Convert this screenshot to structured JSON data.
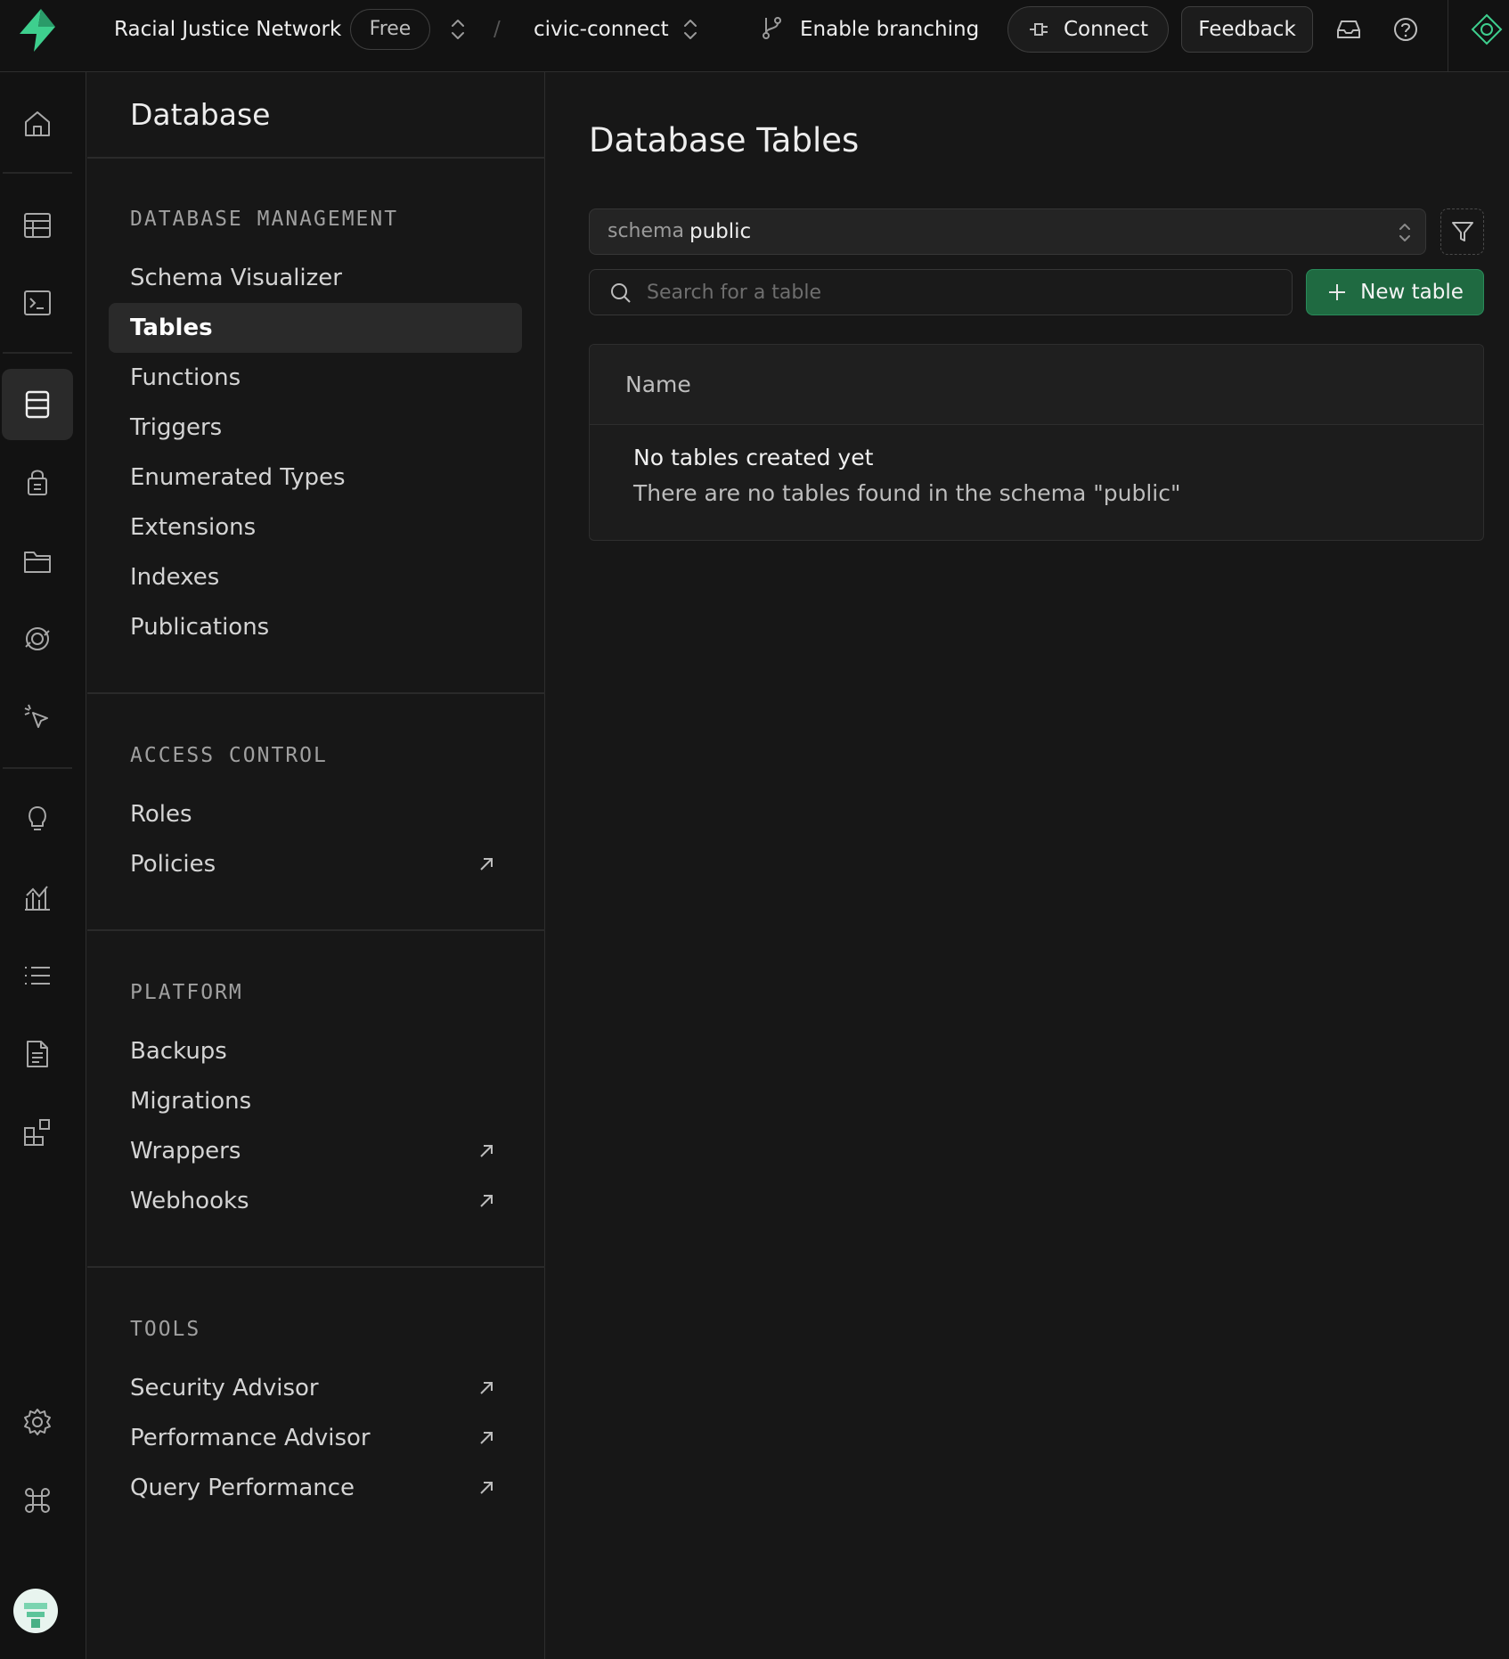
{
  "topbar": {
    "org_name": "Racial Justice Network",
    "plan_badge": "Free",
    "separator": "/",
    "project_name": "civic-connect",
    "branching_label": "Enable branching",
    "connect_label": "Connect",
    "feedback_label": "Feedback"
  },
  "rail": {
    "icons": [
      "home-icon",
      "table-editor-icon",
      "sql-editor-icon",
      "database-icon",
      "auth-icon",
      "storage-icon",
      "realtime-icon",
      "edge-functions-icon",
      "advisors-icon",
      "reports-icon",
      "logs-icon",
      "api-docs-icon",
      "integrations-icon",
      "settings-icon",
      "command-icon"
    ]
  },
  "sidebar": {
    "title": "Database",
    "sections": [
      {
        "heading": "DATABASE MANAGEMENT",
        "items": [
          {
            "label": "Schema Visualizer",
            "external": false,
            "active": false
          },
          {
            "label": "Tables",
            "external": false,
            "active": true
          },
          {
            "label": "Functions",
            "external": false,
            "active": false
          },
          {
            "label": "Triggers",
            "external": false,
            "active": false
          },
          {
            "label": "Enumerated Types",
            "external": false,
            "active": false
          },
          {
            "label": "Extensions",
            "external": false,
            "active": false
          },
          {
            "label": "Indexes",
            "external": false,
            "active": false
          },
          {
            "label": "Publications",
            "external": false,
            "active": false
          }
        ]
      },
      {
        "heading": "ACCESS CONTROL",
        "items": [
          {
            "label": "Roles",
            "external": false,
            "active": false
          },
          {
            "label": "Policies",
            "external": true,
            "active": false
          }
        ]
      },
      {
        "heading": "PLATFORM",
        "items": [
          {
            "label": "Backups",
            "external": false,
            "active": false
          },
          {
            "label": "Migrations",
            "external": false,
            "active": false
          },
          {
            "label": "Wrappers",
            "external": true,
            "active": false
          },
          {
            "label": "Webhooks",
            "external": true,
            "active": false
          }
        ]
      },
      {
        "heading": "TOOLS",
        "items": [
          {
            "label": "Security Advisor",
            "external": true,
            "active": false
          },
          {
            "label": "Performance Advisor",
            "external": true,
            "active": false
          },
          {
            "label": "Query Performance",
            "external": true,
            "active": false
          }
        ]
      }
    ]
  },
  "main": {
    "title": "Database Tables",
    "schema_key": "schema",
    "schema_value": "public",
    "search_placeholder": "Search for a table",
    "search_value": "",
    "new_table_label": "New table",
    "table_header": "Name",
    "empty_title": "No tables created yet",
    "empty_description": "There are no tables found in the schema \"public\""
  },
  "colors": {
    "brand_green": "#3ecf8e",
    "button_green": "#1f6a41",
    "background": "#171717"
  }
}
